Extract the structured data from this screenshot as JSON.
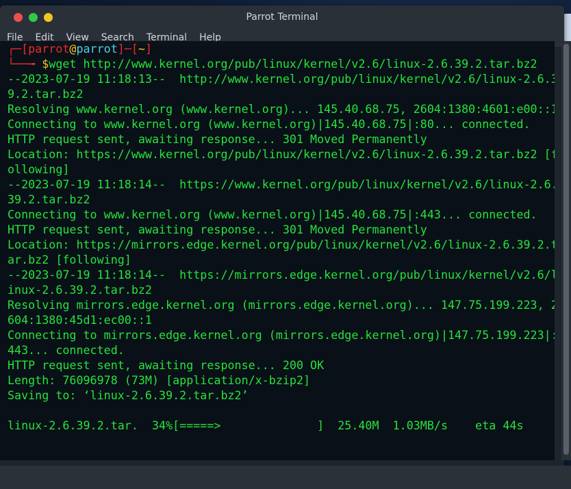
{
  "window": {
    "title": "Parrot Terminal"
  },
  "menu": [
    "File",
    "Edit",
    "View",
    "Search",
    "Terminal",
    "Help"
  ],
  "prompt": {
    "open": "┌─[",
    "user": "parrot",
    "at": "@",
    "host": "parrot",
    "mid": "]─[",
    "dir": "~",
    "close": "]",
    "arrow": "└──╼ ",
    "dollar": "$",
    "command": "wget http://www.kernel.org/pub/linux/kernel/v2.6/linux-2.6.39.2.tar.bz2"
  },
  "output": [
    "--2023-07-19 11:18:13--  http://www.kernel.org/pub/linux/kernel/v2.6/linux-2.6.3",
    "9.2.tar.bz2",
    "Resolving www.kernel.org (www.kernel.org)... 145.40.68.75, 2604:1380:4601:e00::1",
    "Connecting to www.kernel.org (www.kernel.org)|145.40.68.75|:80... connected.",
    "HTTP request sent, awaiting response... 301 Moved Permanently",
    "Location: https://www.kernel.org/pub/linux/kernel/v2.6/linux-2.6.39.2.tar.bz2 [f",
    "ollowing]",
    "--2023-07-19 11:18:14--  https://www.kernel.org/pub/linux/kernel/v2.6/linux-2.6.",
    "39.2.tar.bz2",
    "Connecting to www.kernel.org (www.kernel.org)|145.40.68.75|:443... connected.",
    "HTTP request sent, awaiting response... 301 Moved Permanently",
    "Location: https://mirrors.edge.kernel.org/pub/linux/kernel/v2.6/linux-2.6.39.2.t",
    "ar.bz2 [following]",
    "--2023-07-19 11:18:14--  https://mirrors.edge.kernel.org/pub/linux/kernel/v2.6/l",
    "inux-2.6.39.2.tar.bz2",
    "Resolving mirrors.edge.kernel.org (mirrors.edge.kernel.org)... 147.75.199.223, 2",
    "604:1380:45d1:ec00::1",
    "Connecting to mirrors.edge.kernel.org (mirrors.edge.kernel.org)|147.75.199.223|:",
    "443... connected.",
    "HTTP request sent, awaiting response... 200 OK",
    "Length: 76096978 (73M) [application/x-bzip2]",
    "Saving to: ‘linux-2.6.39.2.tar.bz2’",
    "",
    "linux-2.6.39.2.tar.  34%[=====>              ]  25.40M  1.03MB/s    eta 44s"
  ],
  "colors": {
    "text_green": "#26e33a",
    "prompt_red": "#ee2b2b",
    "host_cyan": "#4fd2e0",
    "accent_yellow": "#f4c325"
  }
}
